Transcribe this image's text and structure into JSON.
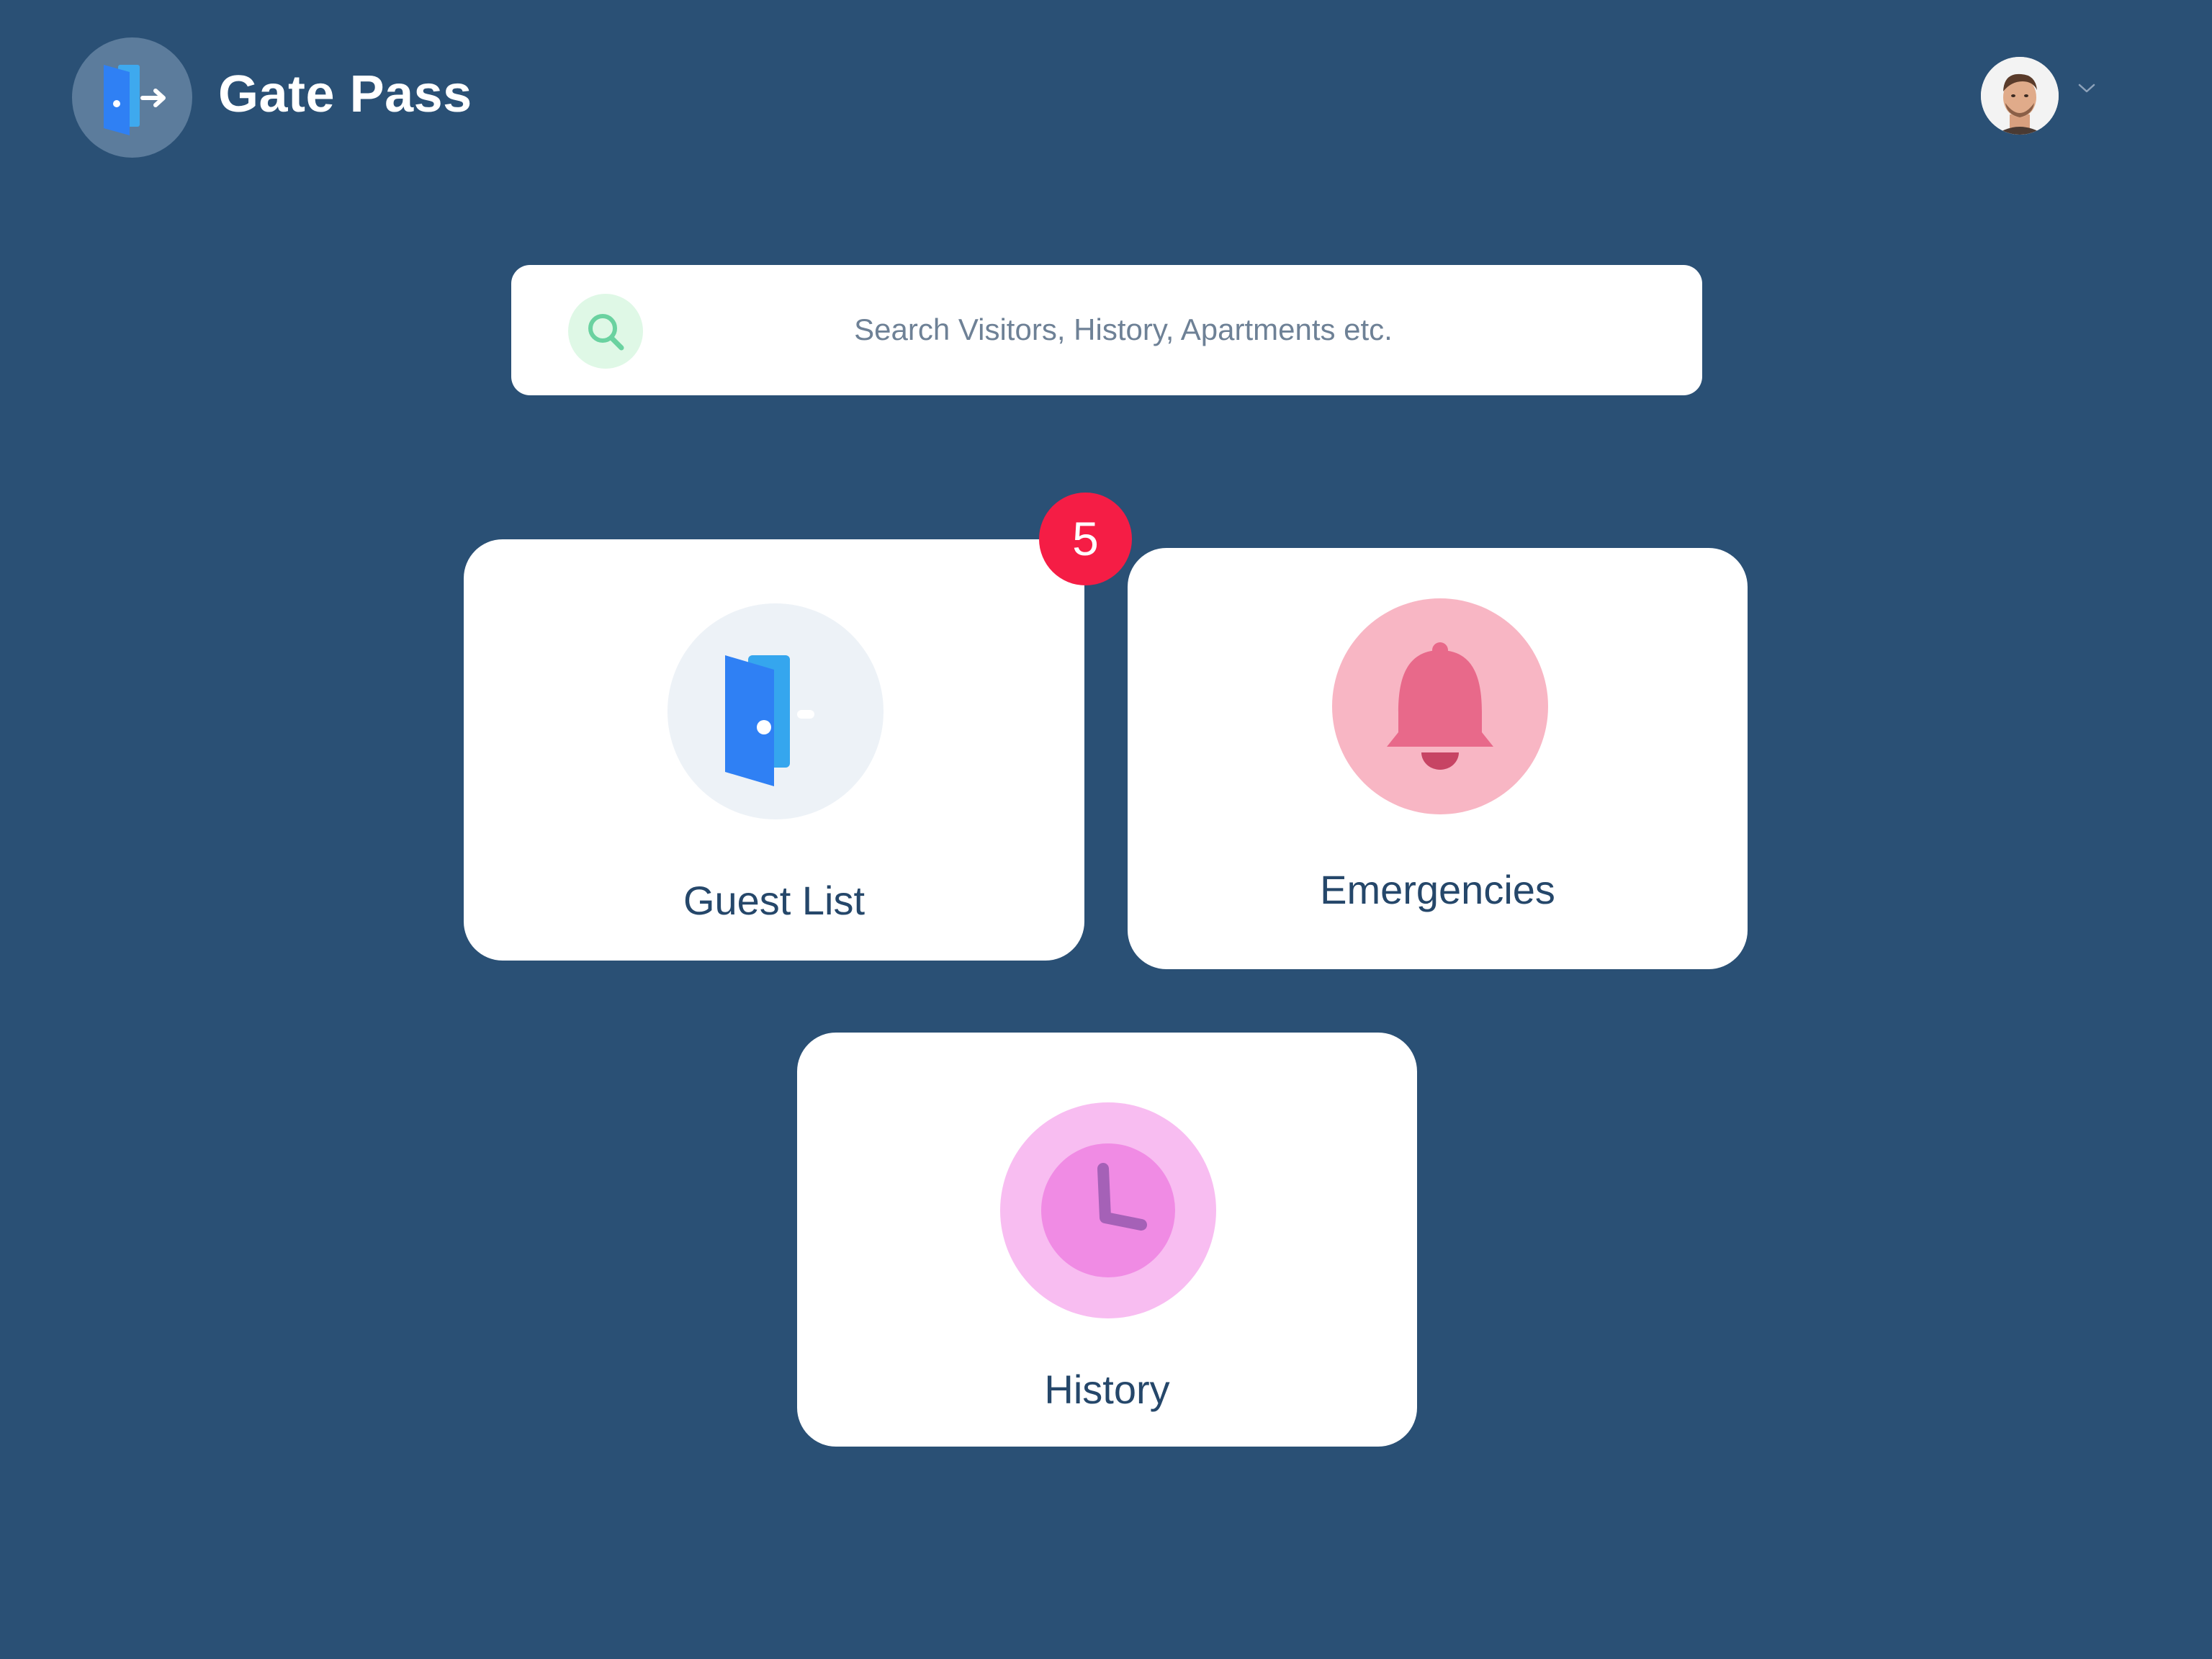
{
  "header": {
    "app_title": "Gate Pass",
    "logo_icon": "door-exit-icon",
    "user_menu": {
      "avatar_icon": "user-avatar",
      "dropdown_icon": "chevron-down-icon"
    }
  },
  "search": {
    "icon": "search-icon",
    "placeholder": "Search Visitors, History, Apartments etc."
  },
  "tiles": {
    "guest_list": {
      "label": "Guest List",
      "icon": "door-icon",
      "badge_count": "5"
    },
    "emergencies": {
      "label": "Emergencies",
      "icon": "bell-icon"
    },
    "history": {
      "label": "History",
      "icon": "clock-icon"
    }
  },
  "colors": {
    "background": "#2a5075",
    "card": "#ffffff",
    "label_text": "#25476a",
    "badge": "#f51d45",
    "door_blue": "#2f80f4",
    "bell_pink": "#e8698a",
    "clock_magenta": "#f08be4",
    "search_green": "#7fd6aa"
  }
}
